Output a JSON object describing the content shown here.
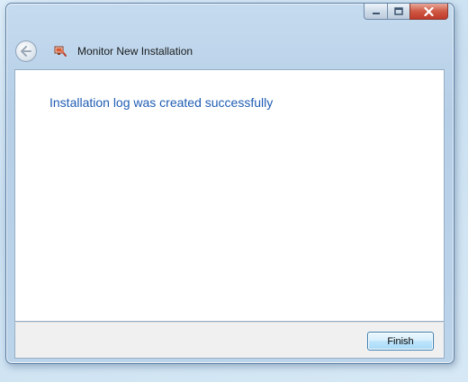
{
  "window": {
    "title": "Monitor New Installation",
    "caption_buttons": {
      "minimize_icon": "minimize-icon",
      "maximize_icon": "maximize-icon",
      "close_icon": "close-icon"
    }
  },
  "nav": {
    "back_icon": "back-arrow-icon"
  },
  "app_icon": "monitor-config-icon",
  "content": {
    "headline": "Installation log was created successfully"
  },
  "footer": {
    "finish_label": "Finish"
  },
  "colors": {
    "headline": "#1e5cb3",
    "close_button": "#c0392b",
    "frame": "#b6cfe7"
  }
}
